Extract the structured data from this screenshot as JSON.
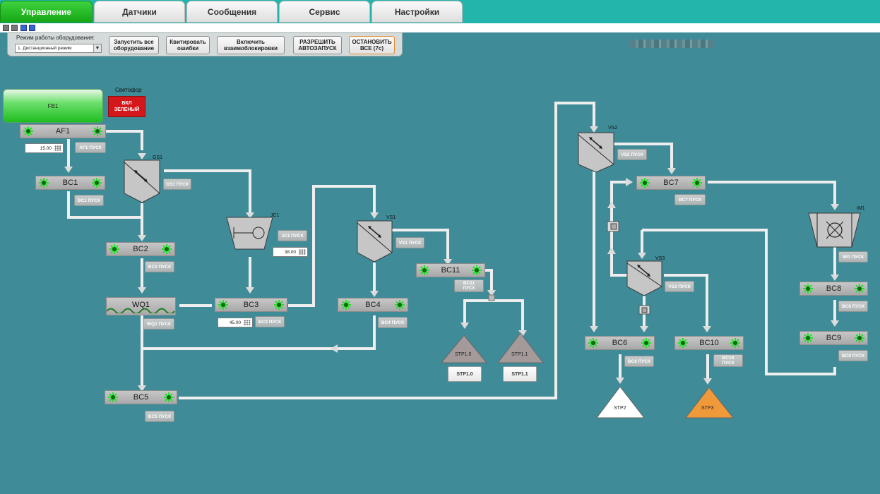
{
  "tabs": [
    {
      "label": "Управление",
      "active": true
    },
    {
      "label": "Датчики"
    },
    {
      "label": "Сообщения"
    },
    {
      "label": "Сервис"
    },
    {
      "label": "Настройки"
    }
  ],
  "toolbar": {
    "mode_label": "Режим работы оборудования:",
    "mode_value": "1. Дистанционный режим",
    "btn_start": [
      "Запустить все",
      "оборудование"
    ],
    "btn_ack": [
      "Квитировать",
      "ошибки"
    ],
    "btn_interlock": [
      "Включить",
      "взаимоблокировки"
    ],
    "btn_autostart": [
      "РАЗРЕШИТЬ",
      "АВТОЗАПУСК"
    ],
    "btn_stop": [
      "ОСТАНОВИТЬ",
      "ВСЕ (7с)"
    ]
  },
  "fb1": {
    "label": "FB1"
  },
  "traffic": {
    "title": "Светофор",
    "button": [
      "ВКЛ",
      "ЗЕЛЕНЫЙ"
    ]
  },
  "units": {
    "AF1": "AF1",
    "BC1": "BC1",
    "BC2": "BC2",
    "BC3": "BC3",
    "BC4": "BC4",
    "BC5": "BC5",
    "BC6": "BC6",
    "BC7": "BC7",
    "BC8": "BC8",
    "BC9": "BC9",
    "BC10": "BC10",
    "BC11": "BC11",
    "WQ1": "WQ1"
  },
  "equipment_labels": {
    "GS1": "GS1",
    "JC1": "JC1",
    "VS1": "VS1",
    "VS2": "VS2",
    "VS3": "VS3",
    "IM1": "IM1"
  },
  "pusk": {
    "AF1": "AF1 ПУСК",
    "GS1": "GS1 ПУСК",
    "BC1": "BC1 ПУСК",
    "BC2": "BC2 ПУСК",
    "JC1": "JC1 ПУСК",
    "VS1": "VS1 ПУСК",
    "BC11": [
      "BC11",
      "ПУСК"
    ],
    "WQ1": "WQ1 ПУСК",
    "BC3": "BC3 ПУСК",
    "BC4": "BC4 ПУСК",
    "BC5": "BC5 ПУСК",
    "VS2": "VS2 ПУСК",
    "BC7": "BC7 ПУСК",
    "VS3": "VS3 ПУСК",
    "BC6": "BC6 ПУСК",
    "BC10": [
      "BC10",
      "ПУСК"
    ],
    "IM1": "IM1 ПУСК",
    "BC8": "BC8 ПУСК",
    "BC9": "BC9 ПУСК"
  },
  "setpoints": {
    "AF1": "15.00",
    "JC1": "38.00",
    "BC3": "45.00"
  },
  "stockpiles": {
    "STP1_0": {
      "label": "STP1.0",
      "button": "STP1.0",
      "color": "#a59a9a"
    },
    "STP1_1": {
      "label": "STP1.1",
      "button": "STP1.1",
      "color": "#a59a9a"
    },
    "STP2": {
      "label": "STP2",
      "color": "#ffffff"
    },
    "STP3": {
      "label": "STP3",
      "color": "#f0993a"
    }
  },
  "colors": {
    "background": "#3f8c98",
    "tabbar": "#23b4ac",
    "active_tab": "#22b722",
    "fan": "#2ee62e",
    "alarm": "#d4171b",
    "pipe": "#eeeeee"
  }
}
